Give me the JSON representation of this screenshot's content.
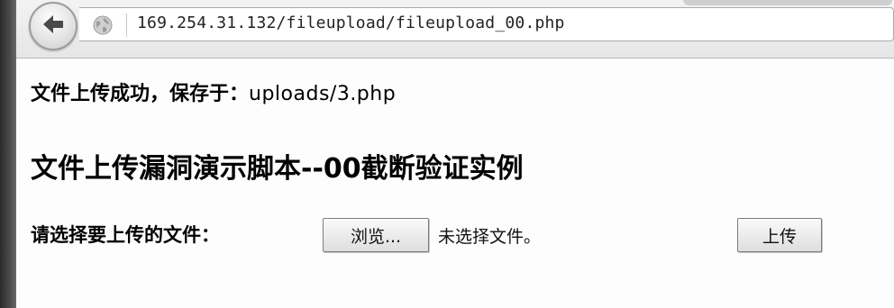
{
  "browser": {
    "url": "169.254.31.132/fileupload/fileupload_00.php"
  },
  "page": {
    "success_label": "文件上传成功，保存于：",
    "success_path": "uploads/3.php",
    "title": "文件上传漏洞演示脚本--00截断验证实例"
  },
  "form": {
    "label": "请选择要上传的文件：",
    "browse_button": "浏览...",
    "no_file_text": "未选择文件。",
    "upload_button": "上传"
  },
  "icons": {
    "back": "arrow-left-icon",
    "site": "globe-icon"
  }
}
